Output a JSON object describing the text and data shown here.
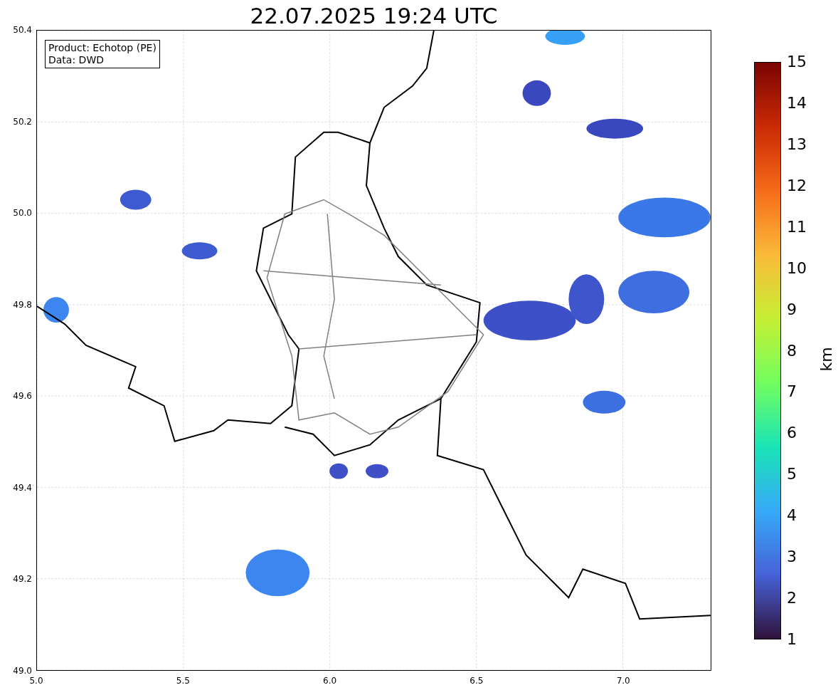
{
  "title": "22.07.2025 19:24 UTC",
  "legend": [
    "Product: Echotop (PE)",
    "Data: DWD"
  ],
  "x_ticks": [
    "5.0",
    "5.5",
    "6.0",
    "6.5",
    "7.0"
  ],
  "y_ticks": [
    "50.4",
    "50.2",
    "50.0",
    "49.8",
    "49.6",
    "49.4",
    "49.2",
    "49.0"
  ],
  "colorbar": {
    "label": "km",
    "ticks": [
      "15",
      "14",
      "13",
      "12",
      "11",
      "10",
      "9",
      "8",
      "7",
      "6",
      "5",
      "4",
      "3",
      "2",
      "1"
    ]
  }
}
